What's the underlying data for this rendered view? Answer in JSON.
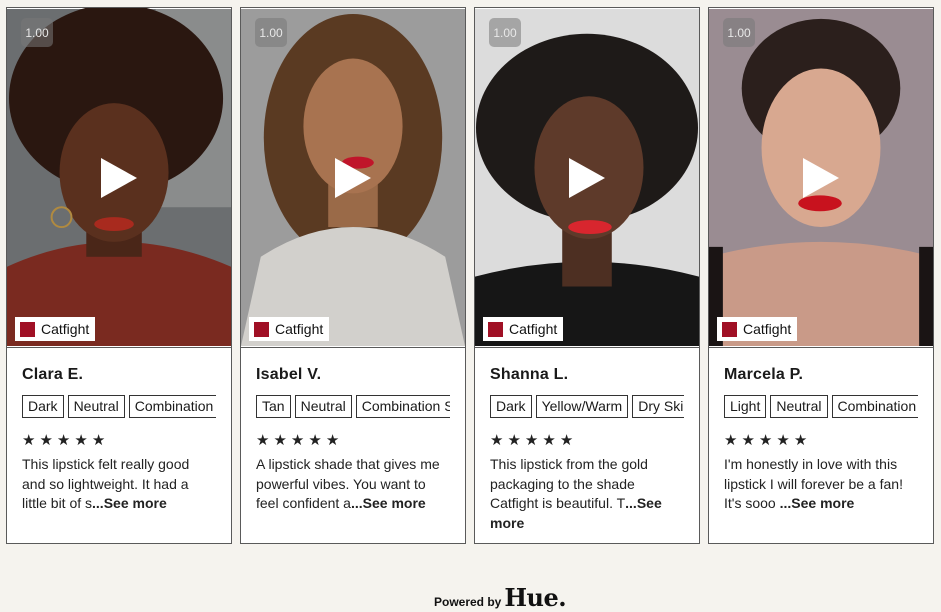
{
  "cards": [
    {
      "speed": "1.00",
      "shade": "Catfight",
      "name": "Clara E.",
      "tags": [
        "Dark",
        "Neutral",
        "Combination"
      ],
      "rating": 5,
      "review_text": "This lipstick felt really good and so lightweight. It had a little bit of s",
      "see_more": "...See more"
    },
    {
      "speed": "1.00",
      "shade": "Catfight",
      "name": "Isabel V.",
      "tags": [
        "Tan",
        "Neutral",
        "Combination S"
      ],
      "rating": 5,
      "review_text": "A lipstick shade that gives me powerful vibes. You want to feel confident a",
      "see_more": "...See more"
    },
    {
      "speed": "1.00",
      "shade": "Catfight",
      "name": "Shanna L.",
      "tags": [
        "Dark",
        "Yellow/Warm",
        "Dry Ski"
      ],
      "rating": 5,
      "review_text": "This lipstick from the gold packaging to the shade Catfight is beautiful. T",
      "see_more": "...See more"
    },
    {
      "speed": "1.00",
      "shade": "Catfight",
      "name": "Marcela P.",
      "tags": [
        "Light",
        "Neutral",
        "Combination"
      ],
      "rating": 5,
      "review_text": "I'm honestly in love with this lipstick I will forever be a fan! It's sooo ",
      "see_more": "...See more"
    }
  ],
  "footer": {
    "powered_by": "Powered by",
    "brand": "Hue."
  },
  "colors": {
    "shade_swatch": "#a01025",
    "background": "#f5f3ee"
  }
}
